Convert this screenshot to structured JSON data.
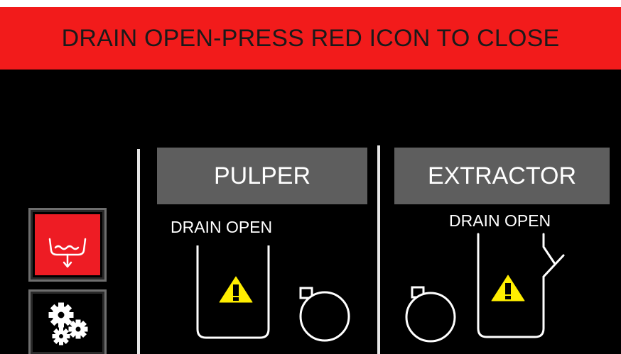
{
  "banner": {
    "message": "DRAIN OPEN-PRESS RED ICON TO CLOSE",
    "color": "#f21b1b"
  },
  "sidebar": {
    "drain_button": {
      "icon": "drain-icon",
      "color": "#ee1c24"
    },
    "settings_button": {
      "icon": "gears-icon"
    }
  },
  "pulper": {
    "title": "PULPER",
    "status": "DRAIN OPEN",
    "icons": [
      "tank-icon",
      "warning-icon",
      "pump-icon"
    ]
  },
  "extractor": {
    "title": "EXTRACTOR",
    "status": "DRAIN OPEN",
    "icons": [
      "pump-icon",
      "tank-icon",
      "warning-icon"
    ]
  },
  "warning_color": "#ffee00"
}
